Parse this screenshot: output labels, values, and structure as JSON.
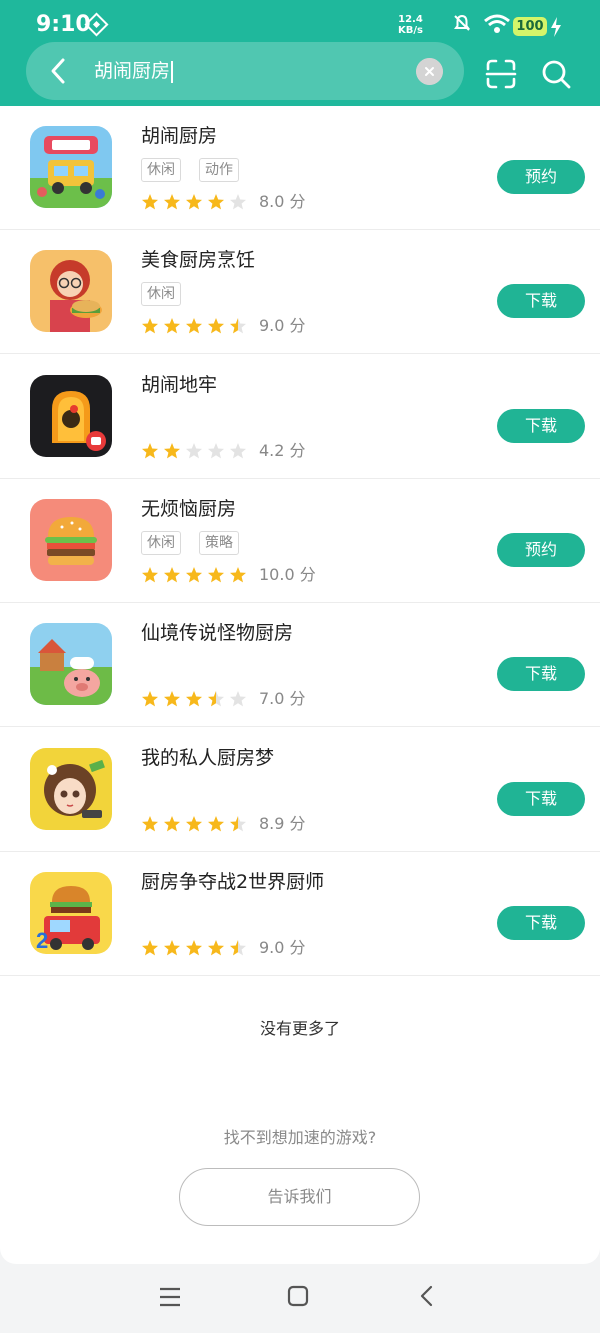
{
  "status_bar": {
    "time": "9:10",
    "speed_value": "12.4",
    "speed_unit": "KB/s",
    "battery": "100"
  },
  "search": {
    "query": "胡闹厨房"
  },
  "results": [
    {
      "name": "胡闹厨房",
      "tags": [
        "休闲",
        "动作"
      ],
      "rating": 4,
      "score": "8.0 分",
      "action": "预约",
      "icon": "overcooked-icon"
    },
    {
      "name": "美食厨房烹饪",
      "tags": [
        "休闲"
      ],
      "rating": 4.5,
      "score": "9.0 分",
      "action": "下载",
      "icon": "chef-girl-icon"
    },
    {
      "name": "胡闹地牢",
      "tags": [],
      "rating": 2,
      "score": "4.2 分",
      "action": "下载",
      "icon": "dungeon-door-icon"
    },
    {
      "name": "无烦恼厨房",
      "tags": [
        "休闲",
        "策略"
      ],
      "rating": 5,
      "score": "10.0 分",
      "action": "预约",
      "icon": "burger-icon"
    },
    {
      "name": "仙境传说怪物厨房",
      "tags": [],
      "rating": 3.5,
      "score": "7.0 分",
      "action": "下载",
      "icon": "pig-chef-icon"
    },
    {
      "name": "我的私人厨房梦",
      "tags": [],
      "rating": 4.5,
      "score": "8.9 分",
      "action": "下载",
      "icon": "anime-girl-icon"
    },
    {
      "name": "厨房争夺战2世界厨师",
      "tags": [],
      "rating": 4.5,
      "score": "9.0 分",
      "action": "下载",
      "icon": "food-truck-icon"
    }
  ],
  "footer": {
    "no_more": "没有更多了",
    "cant_find": "找不到想加速的游戏?",
    "tell_us": "告诉我们"
  },
  "colors": {
    "accent": "#1fb89c",
    "button": "#20b495",
    "star": "#f7b81b",
    "star_empty": "#e3e3e3"
  }
}
